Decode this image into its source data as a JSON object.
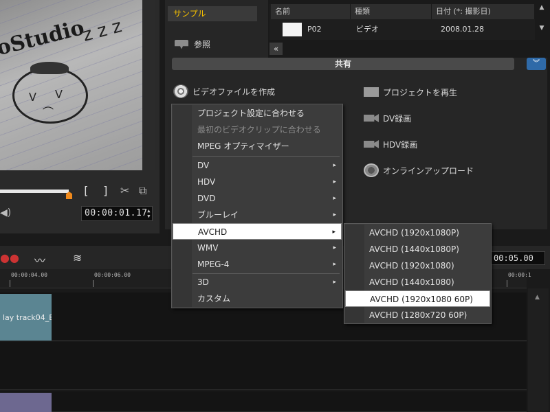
{
  "preview": {
    "watermark": "oStudio",
    "zzz": "z z z",
    "mark_in": "[",
    "mark_out": "]",
    "timecode": "00:00:01.17",
    "scrub_position_fraction": 0.43
  },
  "library": {
    "selected_folder": "サンプル",
    "browse_label": "参照",
    "collapse_label": "«",
    "columns": [
      "名前",
      "種類",
      "日付 (*: 撮影日)"
    ],
    "rows": [
      {
        "name": "P02",
        "type": "ビデオ",
        "date": "2008.01.28"
      }
    ]
  },
  "share": {
    "header": "共有",
    "expand_label": "︾",
    "left_options": {
      "create_video": "ビデオファイルを作成"
    },
    "right_options": [
      {
        "label": "プロジェクトを再生",
        "icon": "film-play-icon"
      },
      {
        "label": "DV録画",
        "icon": "camcorder-icon"
      },
      {
        "label": "HDV録画",
        "icon": "camcorder-icon"
      },
      {
        "label": "オンラインアップロード",
        "icon": "globe-upload-icon"
      }
    ]
  },
  "create_menu": {
    "items": [
      {
        "label": "プロジェクト設定に合わせる",
        "disabled": false,
        "submenu": false
      },
      {
        "label": "最初のビデオクリップに合わせる",
        "disabled": true,
        "submenu": false
      },
      {
        "label": "MPEG オプティマイザー",
        "disabled": false,
        "submenu": false
      },
      {
        "label": "DV",
        "disabled": false,
        "submenu": true
      },
      {
        "label": "HDV",
        "disabled": false,
        "submenu": true
      },
      {
        "label": "DVD",
        "disabled": false,
        "submenu": true
      },
      {
        "label": "ブルーレイ",
        "disabled": false,
        "submenu": true
      },
      {
        "label": "AVCHD",
        "disabled": false,
        "submenu": true,
        "selected": true
      },
      {
        "label": "WMV",
        "disabled": false,
        "submenu": true
      },
      {
        "label": "MPEG-4",
        "disabled": false,
        "submenu": true
      },
      {
        "label": "3D",
        "disabled": false,
        "submenu": true
      },
      {
        "label": "カスタム",
        "disabled": false,
        "submenu": false
      }
    ],
    "chevron": "▸"
  },
  "avchd_menu": {
    "items": [
      {
        "label": "AVCHD (1920x1080P)"
      },
      {
        "label": "AVCHD (1440x1080P)"
      },
      {
        "label": "AVCHD (1920x1080)"
      },
      {
        "label": "AVCHD (1440x1080)"
      },
      {
        "label": "AVCHD (1920x1080 60P)",
        "selected": true
      },
      {
        "label": "AVCHD (1280x720 60P)"
      }
    ]
  },
  "timeline": {
    "timecode": "00:05.00",
    "ruler_labels": [
      "00:00:04.00",
      "00:00:06.00",
      "00:00:1"
    ],
    "clip_label": "lay track04_E",
    "clip_colors": {
      "teal": "#5b8592",
      "purple": "#6d6890"
    }
  },
  "colors": {
    "accent_orange": "#f08a1c",
    "selected_folder_text": "#f5c000",
    "expand_button": "#2f6aa8"
  }
}
